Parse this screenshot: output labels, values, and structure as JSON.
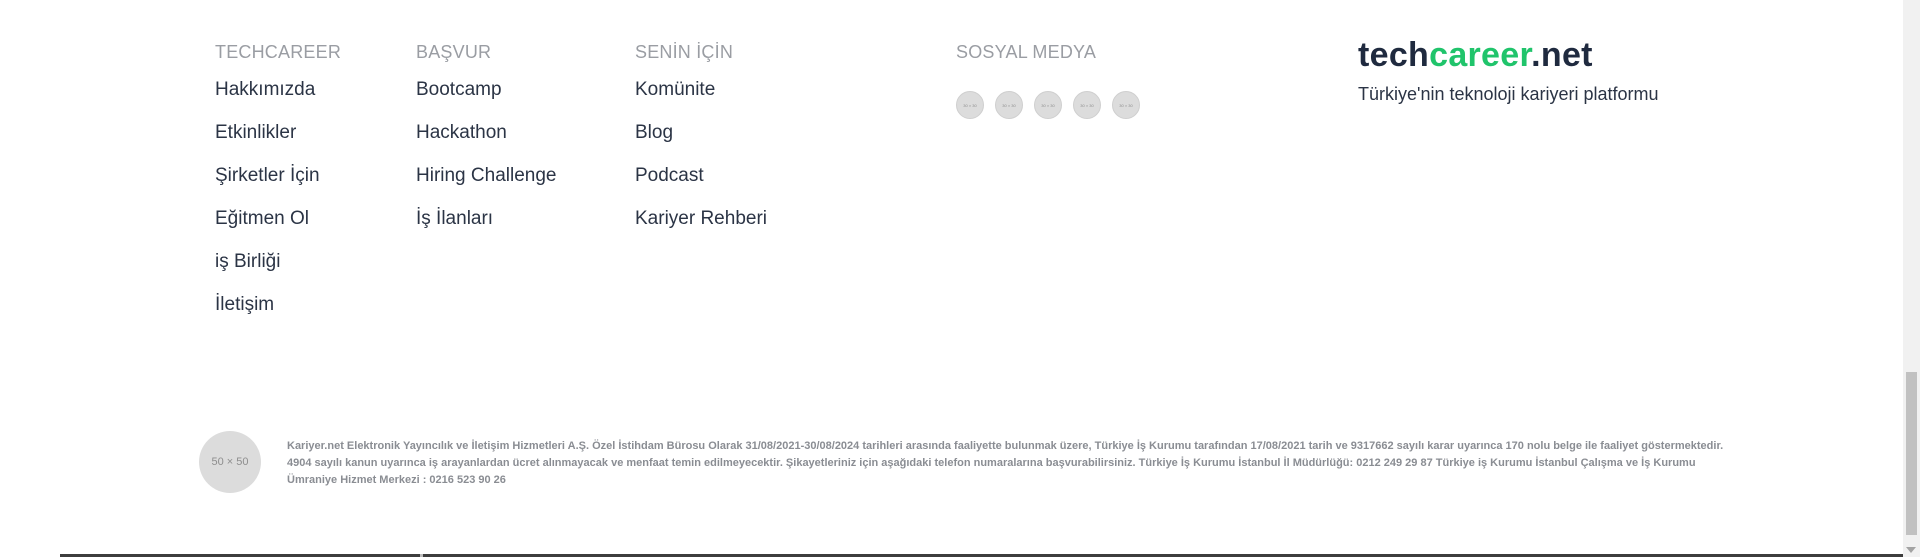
{
  "columns": [
    {
      "heading": "TECHCAREER",
      "links": [
        "Hakkımızda",
        "Etkinlikler",
        "Şirketler İçin",
        "Eğitmen Ol",
        "iş Birliği",
        "İletişim"
      ]
    },
    {
      "heading": "BAŞVUR",
      "links": [
        "Bootcamp",
        "Hackathon",
        "Hiring Challenge",
        "İş İlanları"
      ]
    },
    {
      "heading": "SENİN İÇİN",
      "links": [
        "Komünite",
        "Blog",
        "Podcast",
        "Kariyer Rehberi"
      ]
    }
  ],
  "social": {
    "heading": "SOSYAL MEDYA",
    "icons": [
      {
        "name": "social-icon-1",
        "label": "30 × 30"
      },
      {
        "name": "social-icon-2",
        "label": "30 × 30"
      },
      {
        "name": "social-icon-3",
        "label": "30 × 30"
      },
      {
        "name": "social-icon-4",
        "label": "30 × 30"
      },
      {
        "name": "social-icon-5",
        "label": "30 × 30"
      }
    ]
  },
  "brand": {
    "logo_part1": "tech",
    "logo_part2": "career",
    "logo_part3": ".net",
    "tagline": "Türkiye'nin teknoloji kariyeri platformu",
    "colors": {
      "dark": "#1f2a3f",
      "green": "#20c46b"
    }
  },
  "legal": {
    "badge": "50 × 50",
    "text": "Kariyer.net Elektronik Yayıncılık ve İletişim Hizmetleri A.Ş. Özel İstihdam Bürosu Olarak 31/08/2021-30/08/2024 tarihleri arasında faaliyette bulunmak üzere, Türkiye İş Kurumu tarafından 17/08/2021 tarih ve 9317662 sayılı karar uyarınca 170 nolu belge ile faaliyet göstermektedir. 4904 sayılı kanun uyarınca iş arayanlardan ücret alınmayacak ve menfaat temin edilmeyecektir. Şikayetleriniz için aşağıdaki telefon numaralarına başvurabilirsiniz. Türkiye İş Kurumu İstanbul İl Müdürlüğü: 0212 249 29 87 Türkiye iş Kurumu İstanbul Çalışma ve İş Kurumu Ümraniye Hizmet Merkezi : 0216 523 90 26"
  }
}
